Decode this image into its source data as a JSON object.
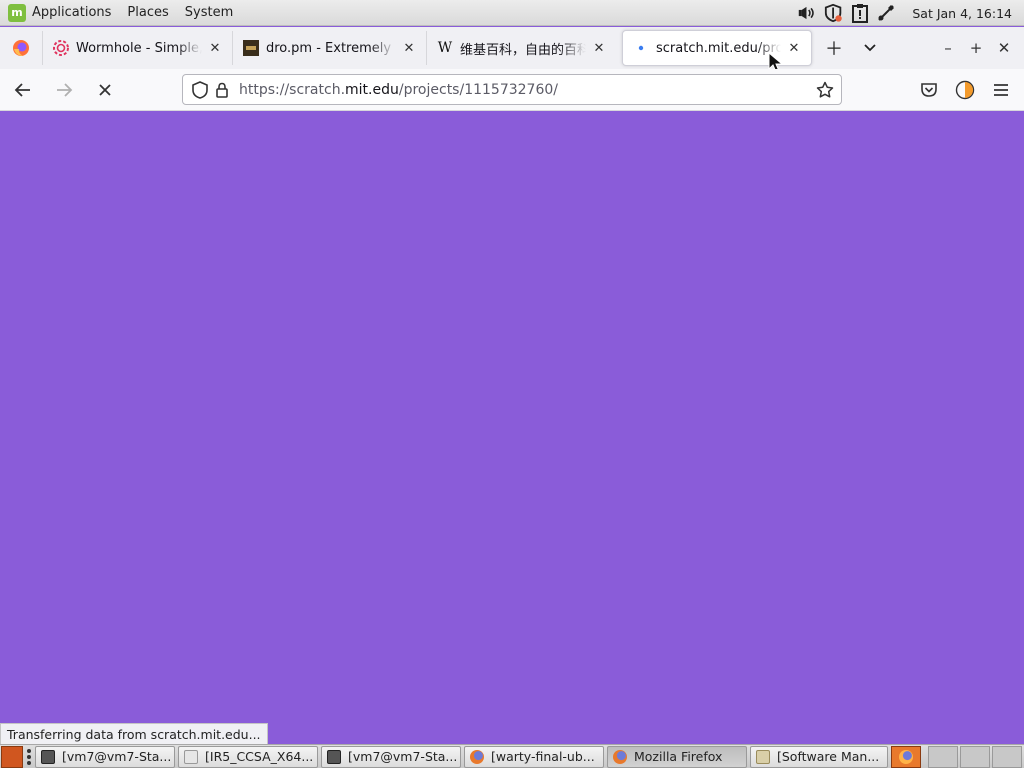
{
  "top_panel": {
    "menus": [
      "Applications",
      "Places",
      "System"
    ],
    "clock": "Sat Jan  4, 16:14"
  },
  "tabs": [
    {
      "title": "Wormhole - Simple, pr",
      "icon": "wormhole-icon"
    },
    {
      "title": "dro.pm - Extremely Sh",
      "icon": "dropm-icon"
    },
    {
      "title": "维基百科，自由的百科",
      "icon": "wikipedia-icon",
      "glyph": "W"
    },
    {
      "title": "scratch.mit.edu/proje",
      "icon": "loading-dot-icon",
      "active": true
    }
  ],
  "nav": {
    "url_prefix": "https://scratch.",
    "url_domain": "mit.edu",
    "url_suffix": "/projects/1115732760/"
  },
  "content": {
    "background_color": "#8a5cd9"
  },
  "status": "Transferring data from scratch.mit.edu...",
  "taskbar": [
    {
      "label": "[vm7@vm7-Sta...",
      "icon": "terminal-icon"
    },
    {
      "label": "[IR5_CCSA_X64...",
      "icon": "disk-icon"
    },
    {
      "label": "[vm7@vm7-Sta...",
      "icon": "terminal-icon"
    },
    {
      "label": "[warty-final-ub...",
      "icon": "firefox-icon"
    },
    {
      "label": "Mozilla Firefox",
      "icon": "firefox-icon",
      "active": true
    },
    {
      "label": "[Software Man...",
      "icon": "package-icon"
    }
  ]
}
